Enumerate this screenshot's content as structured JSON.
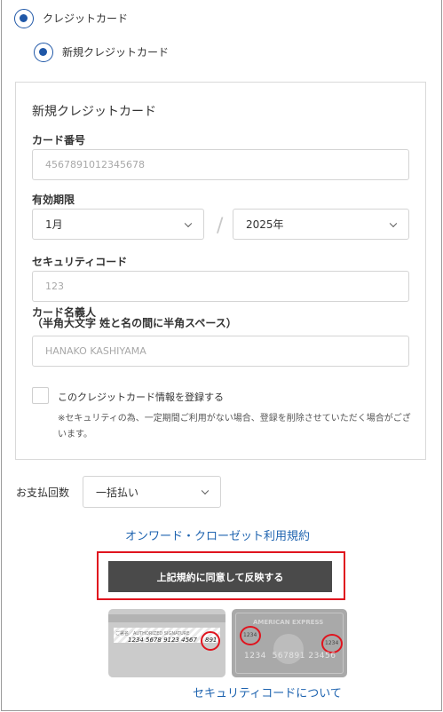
{
  "payment_method": {
    "credit_card_label": "クレジットカード",
    "new_card_label": "新規クレジットカード"
  },
  "card_form": {
    "title": "新規クレジットカード",
    "card_number": {
      "label": "カード番号",
      "placeholder": "4567891012345678"
    },
    "expiry": {
      "label": "有効期限",
      "month_value": "1月",
      "year_value": "2025年",
      "separator": "/"
    },
    "security_code": {
      "label": "セキュリティコード",
      "placeholder": "123"
    },
    "holder": {
      "label_line1": "カード名義人",
      "label_line2": "（半角大文字 姓と名の間に半角スペース）",
      "placeholder": "HANAKO KASHIYAMA"
    },
    "save_card": {
      "label": "このクレジットカード情報を登録する",
      "checked": false,
      "note": "※セキュリティの為、一定期間ご利用がない場合、登録を削除させていただく場合がございます。"
    }
  },
  "installments": {
    "label": "お支払回数",
    "value": "一括払い"
  },
  "terms_link": "オンワード・クローゼット利用規約",
  "submit_button": "上記規約に同意して反映する",
  "security_images": {
    "signature_card": {
      "small_text": "ご署名／AUTHORIZED SIGNATURE",
      "numbers": "1234 5678 9123 4567",
      "code": "891"
    },
    "amex_card": {
      "brand": "AMERICAN EXPRESS",
      "top_code": "1234",
      "numbers": "1234  567891 23456",
      "side_code": "1234"
    }
  },
  "security_code_link": "セキュリティコードについて",
  "colors": {
    "accent_blue": "#1f57a7",
    "link_blue": "#1f64b0",
    "highlight_red": "#e0141e",
    "button_dark": "#4a4a4a"
  }
}
